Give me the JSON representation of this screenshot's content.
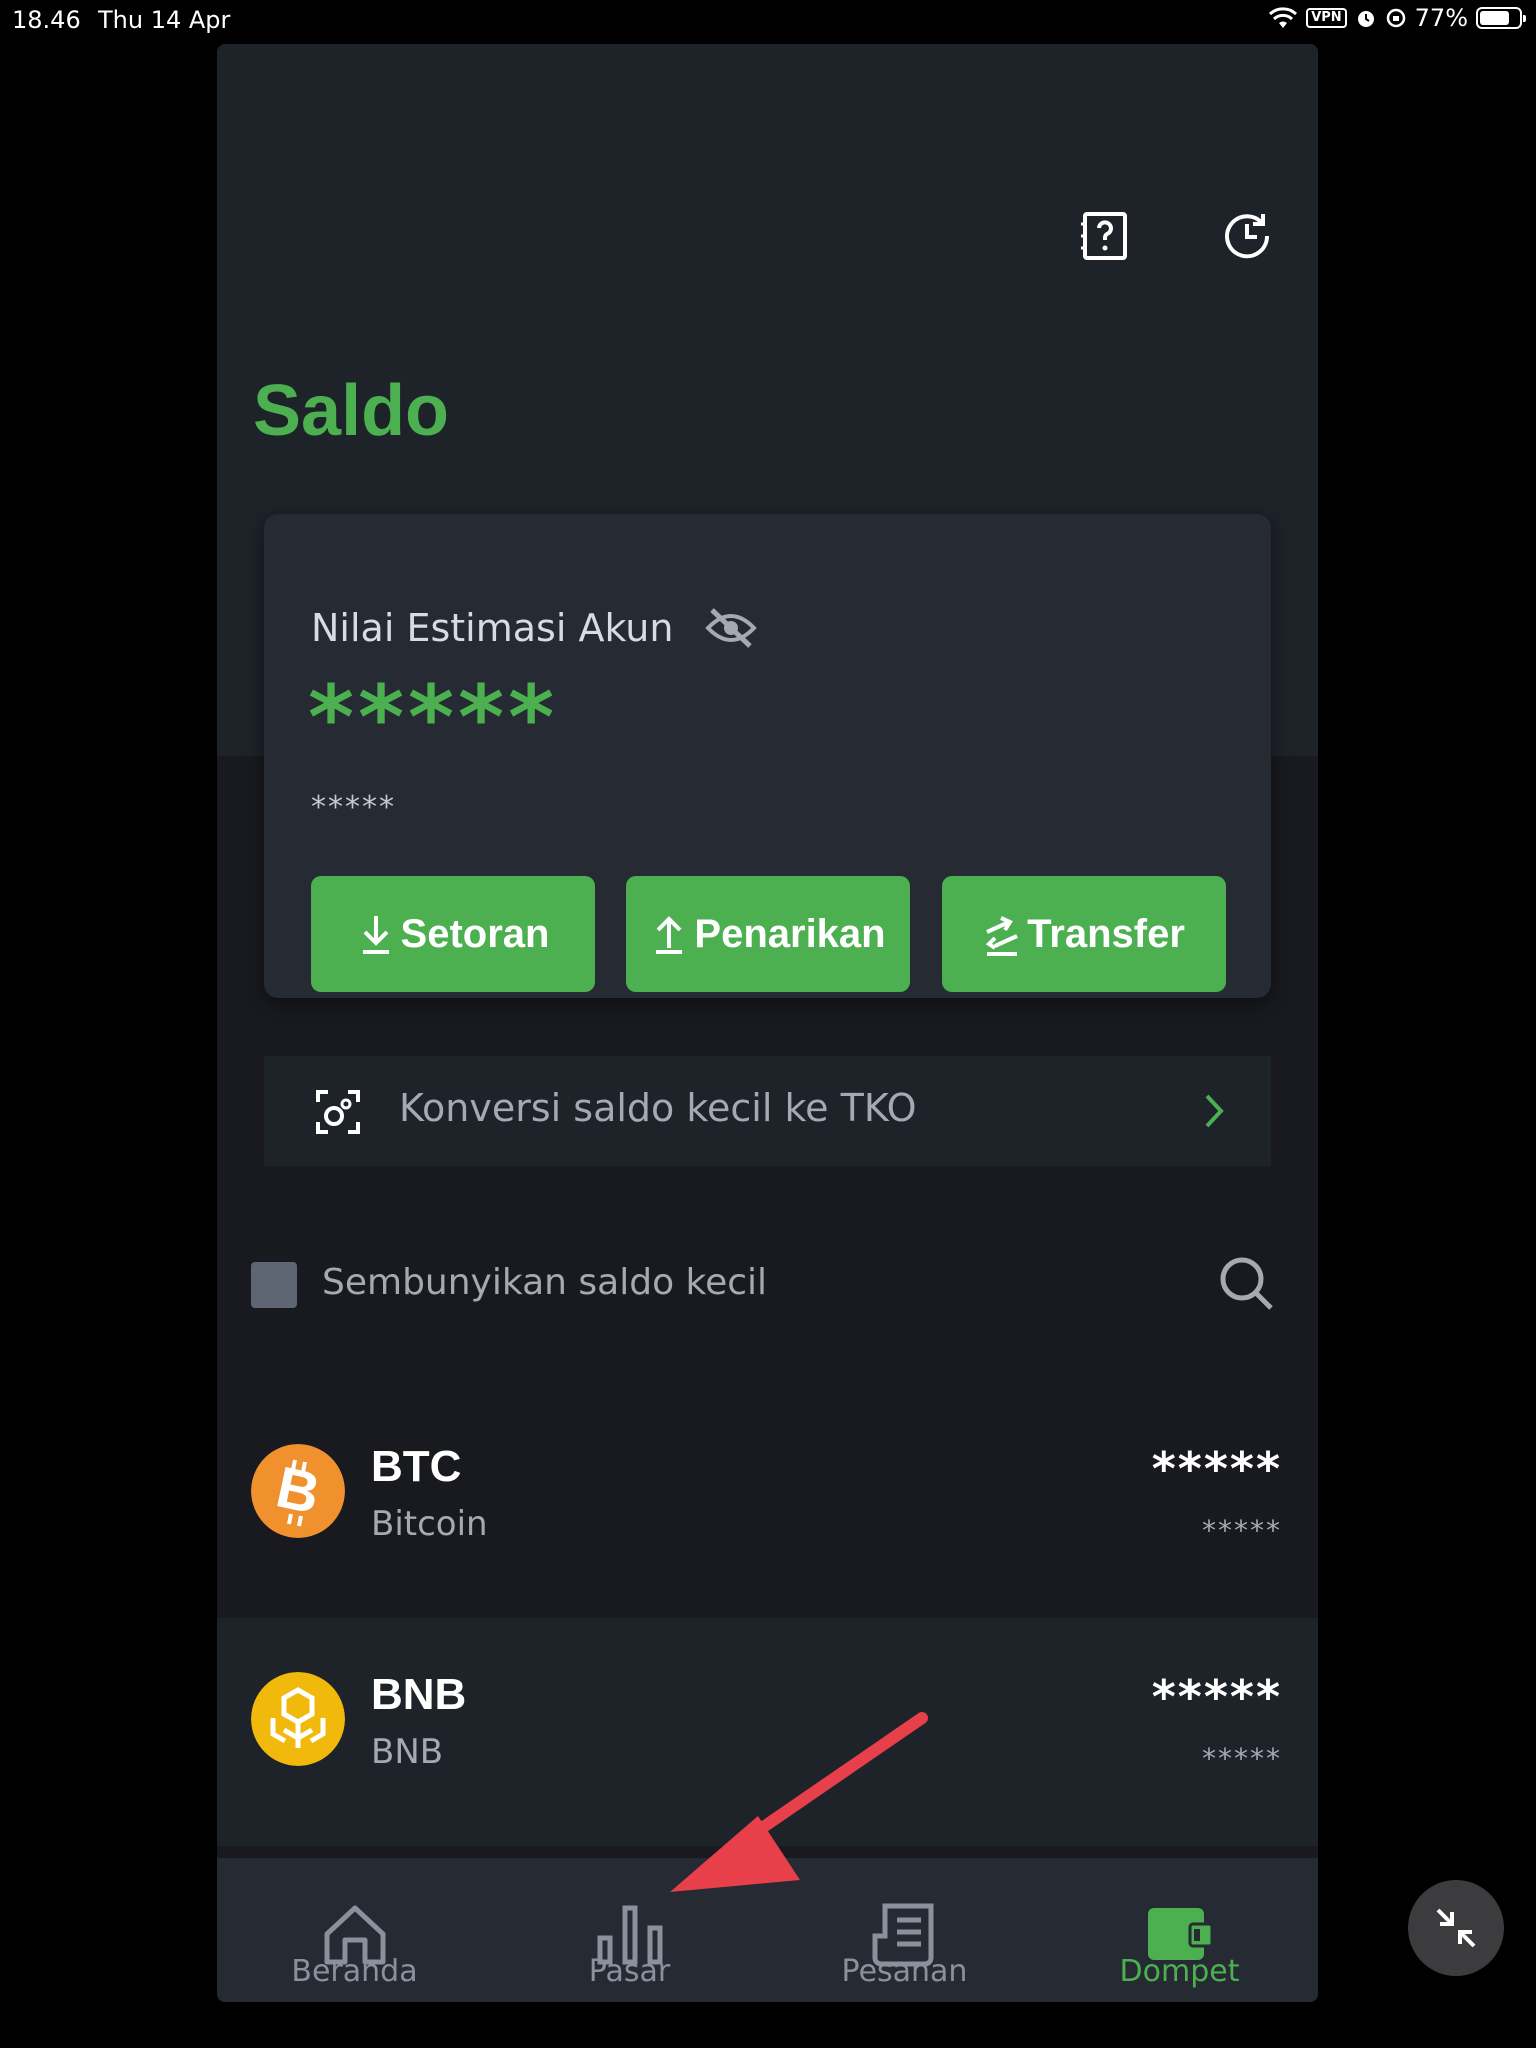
{
  "status_bar": {
    "time": "18.46",
    "date": "Thu 14 Apr",
    "vpn": "VPN",
    "battery": "77%",
    "battery_level": 0.77
  },
  "header": {
    "icons": [
      "help-document-icon",
      "history-icon"
    ]
  },
  "page": {
    "title": "Saldo"
  },
  "balance_card": {
    "label": "Nilai Estimasi Akun",
    "value_main": "*****",
    "value_sub": "*****",
    "buttons": {
      "deposit": "Setoran",
      "withdraw": "Penarikan",
      "transfer": "Transfer"
    }
  },
  "convert_banner": {
    "text": "Konversi saldo kecil ke TKO"
  },
  "hide_small": {
    "label": "Sembunyikan saldo kecil",
    "checked": false
  },
  "assets": [
    {
      "symbol": "BTC",
      "name": "Bitcoin",
      "balance": "*****",
      "balance_sub": "*****",
      "color": "#f0912d"
    },
    {
      "symbol": "BNB",
      "name": "BNB",
      "balance": "*****",
      "balance_sub": "*****",
      "color": "#f0b90b"
    }
  ],
  "bottom_nav": [
    {
      "label": "Beranda",
      "icon": "home-icon",
      "active": false
    },
    {
      "label": "Pasar",
      "icon": "market-bars-icon",
      "active": false
    },
    {
      "label": "Pesanan",
      "icon": "orders-icon",
      "active": false
    },
    {
      "label": "Dompet",
      "icon": "wallet-icon",
      "active": true
    }
  ],
  "colors": {
    "accent": "#4caf50",
    "background": "#181a20",
    "card": "#252a33",
    "annotation_arrow": "#e8404a"
  }
}
